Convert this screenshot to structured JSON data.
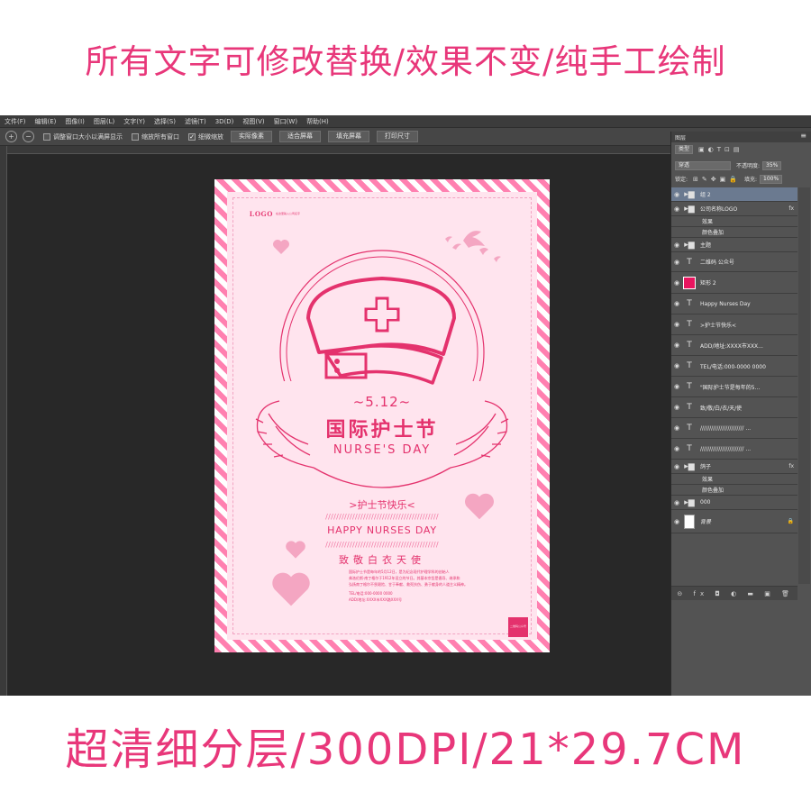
{
  "banner_top": "所有文字可修改替换/效果不变/纯手工绘制",
  "banner_bottom": "超清细分层/300DPI/21*29.7CM",
  "menu": [
    "文件(F)",
    "编辑(E)",
    "图像(I)",
    "图层(L)",
    "文字(Y)",
    "选择(S)",
    "滤镜(T)",
    "3D(D)",
    "视图(V)",
    "窗口(W)",
    "帮助(H)"
  ],
  "options_bar": {
    "check_resize": "调整窗口大小以满屏显示",
    "check_zoom_all": "缩放所有窗口",
    "check_scrubby": "细微缩放",
    "btn_actual": "实际像素",
    "btn_fit": "适合屏幕",
    "btn_fill": "填充屏幕",
    "btn_print": "打印尺寸"
  },
  "poster": {
    "logo": "LOGO",
    "logo_sub": "在这里输入公司名字",
    "date": "~5.12~",
    "title_cn": "国际护士节",
    "title_en": "NURSE'S DAY",
    "happy_cn": ">护士节快乐<",
    "slash": "//////////////////////////////////////////",
    "happy_en": "HAPPY NURSES DAY",
    "salute": "致敬白衣天使",
    "desc": [
      "国际护士节是每年的5月12日，是为纪念现代护理学科的创始人",
      "弗洛伦斯·南丁格尔于1912年设立的节日。其基本宗旨是倡导、继承和",
      "弘扬南丁格尔不畏艰险、甘于奉献、救死扶伤、勇于献身的人道主义精神。"
    ],
    "tel": "TEL/电话:000-0000 0000",
    "addr": "ADD/地址:XXXX市XXX路XXX号",
    "qr_label": "二维码公众号"
  },
  "layers_panel": {
    "title": "图层",
    "filter_kind": "类型",
    "blend_mode": "穿透",
    "opacity_label": "不透明度:",
    "opacity_value": "35%",
    "lock_label": "锁定:",
    "fill_label": "填充:",
    "fill_value": "100%",
    "layers": [
      {
        "name": "组 2",
        "type": "group",
        "selected": true
      },
      {
        "name": "公司名称LOGO",
        "type": "group",
        "fx": "fx"
      },
      {
        "name": "效果",
        "type": "sub"
      },
      {
        "name": "颜色叠加",
        "type": "sub"
      },
      {
        "name": "主题",
        "type": "group"
      },
      {
        "name": "二维码 公众号",
        "type": "text"
      },
      {
        "name": "矩形 2",
        "type": "shape"
      },
      {
        "name": "Happy Nurses Day",
        "type": "text"
      },
      {
        "name": ">护士节快乐<",
        "type": "text"
      },
      {
        "name": "ADD/地址:XXXX市XXX...",
        "type": "text"
      },
      {
        "name": "TEL/电话:000-0000 0000",
        "type": "text"
      },
      {
        "name": "\"国际护士节是每年的5...",
        "type": "text"
      },
      {
        "name": "致/敬/白/衣/天/使",
        "type": "text"
      },
      {
        "name": "//////////////////////// ...",
        "type": "text"
      },
      {
        "name": "//////////////////////// ...",
        "type": "text"
      },
      {
        "name": "鸽子",
        "type": "group",
        "fx": "fx"
      },
      {
        "name": "效果",
        "type": "sub"
      },
      {
        "name": "颜色叠加",
        "type": "sub"
      },
      {
        "name": "000",
        "type": "group"
      },
      {
        "name": "背景",
        "type": "background"
      }
    ]
  },
  "colors": {
    "accent": "#e4326d",
    "banner": "#e8377a",
    "poster_bg": "#ffe4ee",
    "stripe": "#ff80b0"
  }
}
